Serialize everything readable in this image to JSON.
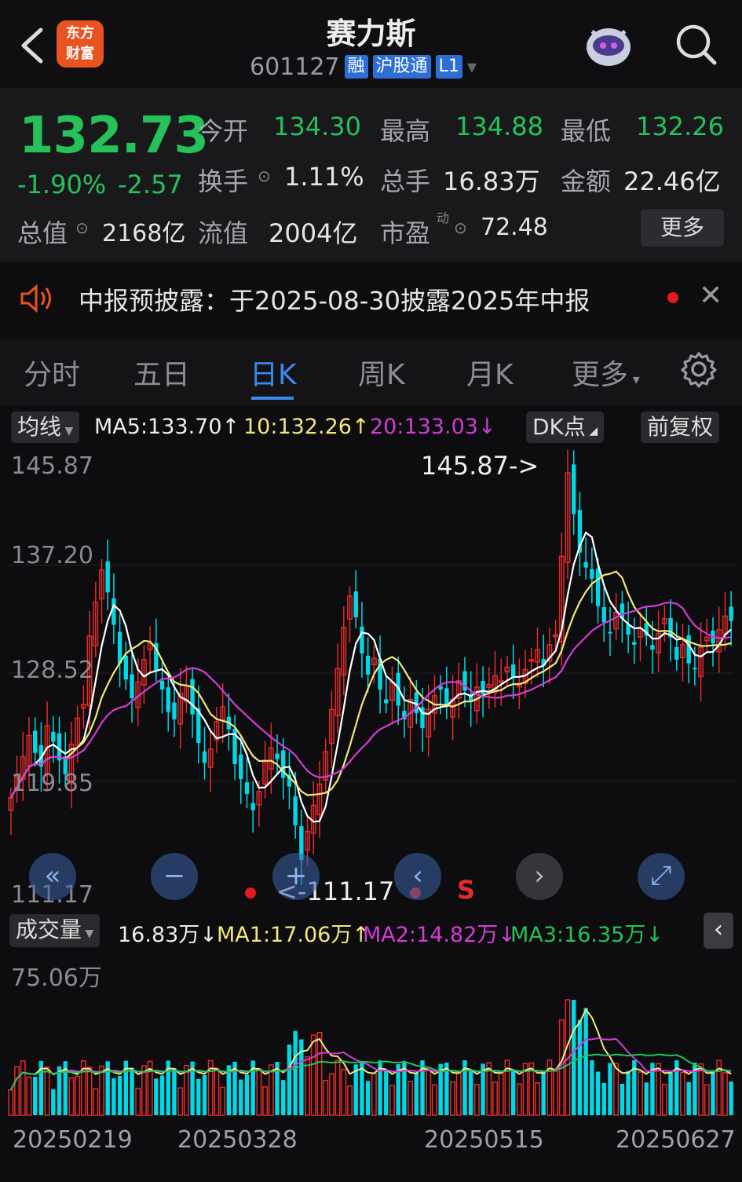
{
  "header": {
    "title": "赛力斯",
    "code": "601127",
    "tags": [
      "融",
      "沪股通",
      "L1"
    ],
    "logo_line1": "东方",
    "logo_line2": "财富"
  },
  "quote": {
    "price": "132.73",
    "pct": "-1.90%",
    "chg": "-2.57",
    "open_label": "今开",
    "open": "134.30",
    "high_label": "最高",
    "high": "134.88",
    "low_label": "最低",
    "low": "132.26",
    "turnover_label": "换手",
    "turnover": "1.11%",
    "volume_label": "总手",
    "volume": "16.83万",
    "amount_label": "金额",
    "amount": "22.46亿",
    "mcap_label": "总值",
    "mcap": "2168亿",
    "float_label": "流值",
    "float": "2004亿",
    "pe_label": "市盈",
    "pe_sup": "动",
    "pe": "72.48",
    "more": "更多"
  },
  "notice": {
    "text": "中报预披露：于2025-08-30披露2025年中报"
  },
  "tabs": [
    "分时",
    "五日",
    "日K",
    "周K",
    "月K",
    "更多"
  ],
  "ma_row": {
    "selector": "均线",
    "ma5": "MA5:133.70",
    "ma10": "10:132.26",
    "ma20": "20:133.03",
    "dk": "DK点",
    "adjust": "前复权"
  },
  "price_axis": [
    "145.87",
    "137.20",
    "128.52",
    "119.85",
    "111.17"
  ],
  "annotations": {
    "high": "145.87->",
    "low": "<-111.17",
    "signal": "S"
  },
  "vol_row": {
    "selector": "成交量",
    "vol": "16.83万",
    "ma1": "MA1:17.06万",
    "ma2": "MA2:14.82万",
    "ma3": "MA3:16.35万",
    "max": "75.06万"
  },
  "dates": [
    "20250219",
    "20250328",
    "20250515",
    "20250627"
  ],
  "colors": {
    "up": "#e32b2b",
    "down": "#00d8e6",
    "ma5": "#ffffff",
    "ma10": "#f3e87a",
    "ma20": "#d43bd6",
    "green": "#25c25a",
    "accent": "#3f87ef"
  },
  "chart_data": {
    "type": "candlestick",
    "price_range": [
      111.17,
      145.87
    ],
    "closes": [
      118.5,
      120.2,
      121.8,
      123.5,
      122.1,
      121.0,
      124.3,
      123.0,
      121.5,
      120.4,
      122.8,
      124.9,
      126.0,
      131.5,
      134.2,
      136.8,
      135.0,
      132.4,
      129.3,
      128.0,
      126.5,
      127.8,
      129.6,
      130.9,
      128.7,
      127.2,
      125.4,
      124.8,
      126.9,
      127.5,
      125.2,
      122.9,
      121.3,
      122.4,
      124.6,
      125.8,
      124.0,
      121.2,
      120.0,
      118.8,
      117.5,
      119.0,
      121.4,
      122.5,
      121.6,
      120.1,
      119.4,
      116.3,
      113.5,
      115.8,
      117.9,
      119.6,
      122.2,
      125.6,
      128.9,
      132.2,
      134.7,
      133.0,
      130.1,
      128.4,
      129.7,
      127.2,
      126.1,
      127.8,
      125.9,
      124.8,
      126.4,
      125.3,
      124.1,
      125.6,
      126.7,
      127.2,
      125.8,
      126.4,
      127.9,
      127.1,
      126.2,
      127.4,
      126.8,
      127.6,
      128.3,
      127.9,
      129.0,
      128.2,
      127.7,
      128.8,
      129.6,
      130.4,
      129.1,
      130.8,
      131.6,
      137.9,
      144.6,
      141.3,
      138.2,
      137.0,
      136.1,
      133.9,
      132.6,
      131.8,
      133.4,
      132.9,
      131.6,
      130.8,
      132.1,
      131.5,
      130.4,
      131.7,
      132.9,
      131.4,
      129.6,
      130.8,
      129.3,
      128.9,
      130.6,
      131.4,
      130.9,
      132.0,
      133.1,
      132.7
    ],
    "volume_max": 75.06,
    "series": [
      {
        "name": "MA5"
      },
      {
        "name": "10"
      },
      {
        "name": "20"
      }
    ]
  }
}
